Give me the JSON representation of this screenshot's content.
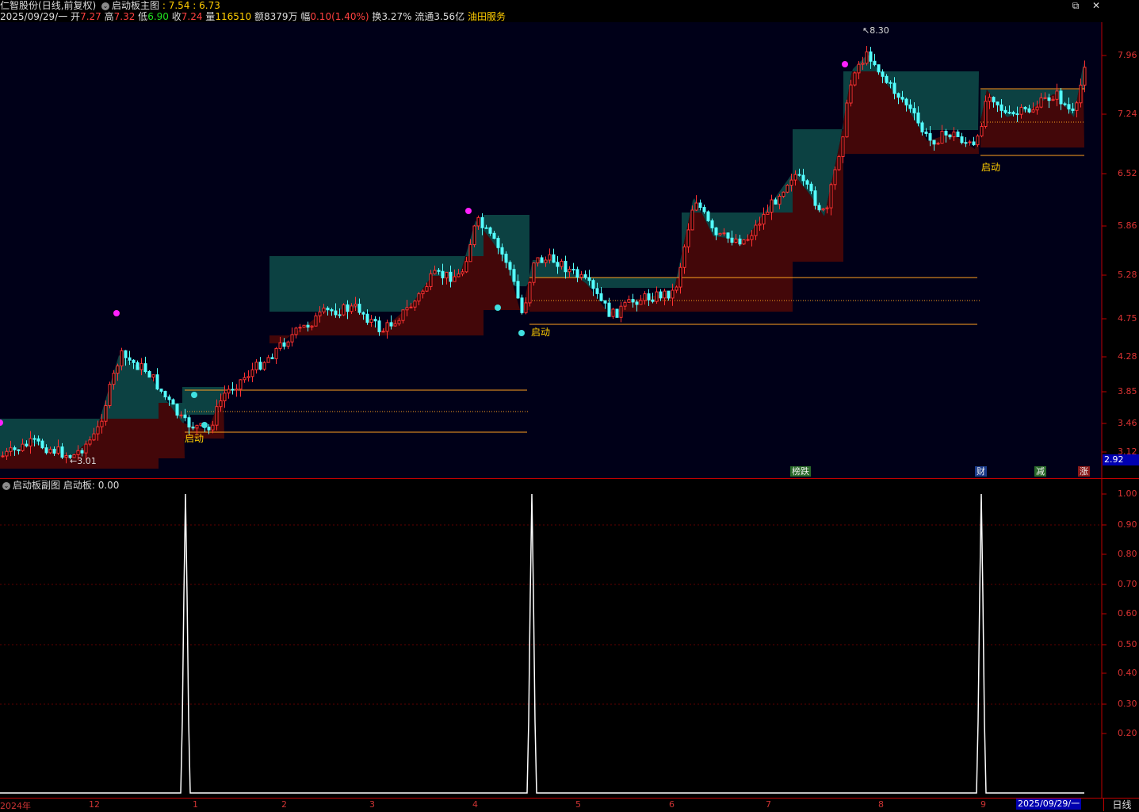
{
  "header": {
    "stock_name": "仁智股份",
    "period_mode": "(日线,前复权)",
    "indicator_name": "启动板主图",
    "indicator_values": ": 7.54 : 6.73",
    "date": "2025/09/29/一",
    "open_label": "开",
    "open": "7.27",
    "high_label": "高",
    "high": "7.32",
    "low_label": "低",
    "low": "6.90",
    "close_label": "收",
    "close": "7.24",
    "vol_label": "量",
    "vol": "116510",
    "amount_label": "额",
    "amount": "8379万",
    "range_label": "幅",
    "range": "0.10(1.40%)",
    "turnover_label": "换",
    "turnover": "3.27%",
    "float_label": "流通",
    "float": "3.56亿",
    "sector": "油田服务"
  },
  "window": {
    "restore": "⧉",
    "close": "✕"
  },
  "main_axis": {
    "labels": [
      "7.96",
      "7.24",
      "6.52",
      "5.86",
      "5.28",
      "4.75",
      "4.28",
      "3.85",
      "3.46",
      "3.12"
    ],
    "current_price": "2.92"
  },
  "sub_axis": {
    "labels": [
      "1.00",
      "0.90",
      "0.80",
      "0.70",
      "0.60",
      "0.50",
      "0.40",
      "0.30",
      "0.20"
    ]
  },
  "annotations": {
    "high_mark": "8.30",
    "low_mark": "3.01",
    "signal_label": "启动"
  },
  "calendar_events": [
    "榜跌",
    "财",
    "减",
    "涨"
  ],
  "sub_chart": {
    "title": "启动板副图",
    "indicator": "启动板",
    "value": "0.00"
  },
  "x_axis": {
    "labels": [
      "2024年",
      "12",
      "1",
      "2",
      "3",
      "4",
      "5",
      "6",
      "7",
      "8",
      "9"
    ],
    "cursor_date": "2025/09/29/一"
  },
  "period_button": "日线",
  "colors": {
    "up": "#ff3232",
    "down": "#54ffff",
    "bg": "#000",
    "frame": "#c00000",
    "launch_line": "#ffa020"
  },
  "chart_data": {
    "type": "candlestick",
    "price_range": [
      2.92,
      8.3
    ],
    "launch_signal_values": [
      0,
      1,
      0,
      1,
      0,
      1,
      0
    ],
    "sub_chart_range": [
      0,
      1
    ],
    "sub_chart_series": [
      {
        "name": "启动板",
        "values": [
          0,
          1,
          0,
          1,
          0,
          1,
          0
        ]
      }
    ]
  }
}
